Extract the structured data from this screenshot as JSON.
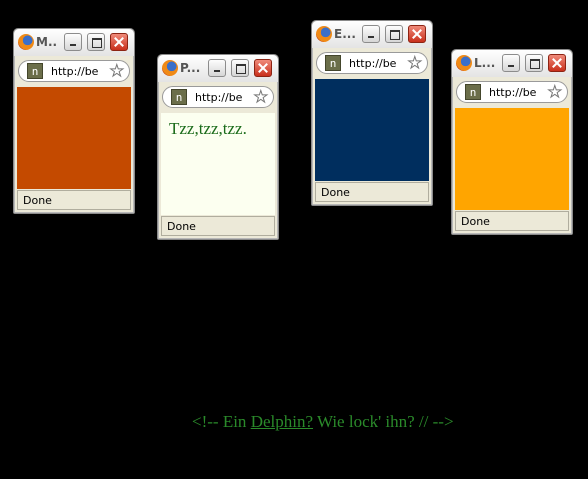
{
  "windows": [
    {
      "id": "w1",
      "title": "M...",
      "url": "http://be",
      "status": "Done",
      "content_color": "#c44a00",
      "site_icon": "n"
    },
    {
      "id": "w2",
      "title": "P...",
      "url": "http://be",
      "status": "Done",
      "content_color": "#fcfff0",
      "site_icon": "n",
      "text": "Tzz,tzz,tzz."
    },
    {
      "id": "w3",
      "title": "E...",
      "url": "http://be",
      "status": "Done",
      "content_color": "#002e5e",
      "site_icon": "n"
    },
    {
      "id": "w4",
      "title": "L...",
      "url": "http://be",
      "status": "Done",
      "content_color": "#ffa500",
      "site_icon": "n"
    }
  ],
  "footer": {
    "prefix": "<!-- Ein ",
    "link": "Delphin?",
    "suffix": " Wie lock' ihn? // -->"
  },
  "icons": {
    "browser": "firefox-icon",
    "minimize": "minimize-icon",
    "maximize": "maximize-icon",
    "close": "close-icon",
    "bookmark": "star-icon"
  }
}
